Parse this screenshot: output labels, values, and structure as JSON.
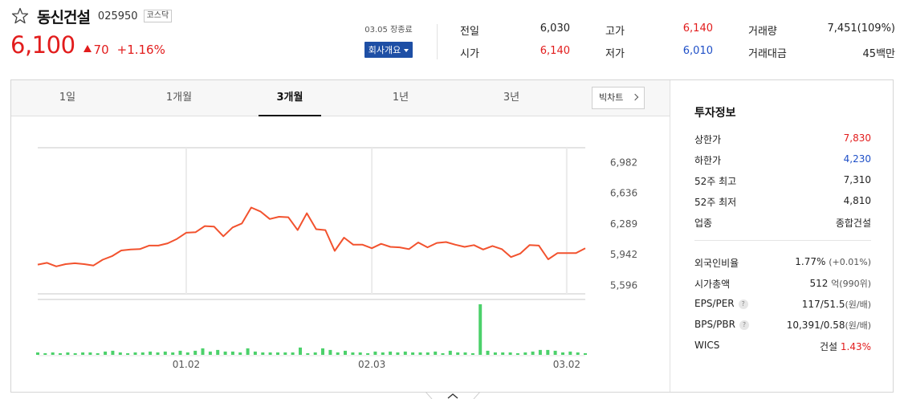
{
  "header": {
    "name": "동신건설",
    "code": "025950",
    "market": "코스닥",
    "price": "6,100",
    "change": "70",
    "change_pct": "+1.16%",
    "status": "03.05 장종료",
    "company_btn": "회사개요"
  },
  "quote": {
    "prev_label": "전일",
    "prev_value": "6,030",
    "open_label": "시가",
    "open_value": "6,140",
    "high_label": "고가",
    "high_value": "6,140",
    "low_label": "저가",
    "low_value": "6,010",
    "volume_label": "거래량",
    "volume_value": "7,451(109%)",
    "amount_label": "거래대금",
    "amount_value": "45백만"
  },
  "tabs": [
    "1일",
    "1개월",
    "3개월",
    "1년",
    "3년"
  ],
  "active_tab": "3개월",
  "bigchart_label": "빅차트",
  "colors": {
    "up": "#e21c1c",
    "down": "#1e4fc7",
    "line": "#f2522e",
    "volume": "#4cd16b"
  },
  "invest": {
    "title": "투자정보",
    "upper_label": "상한가",
    "upper_value": "7,830",
    "lower_label": "하한가",
    "lower_value": "4,230",
    "high52_label": "52주 최고",
    "high52_value": "7,310",
    "low52_label": "52주 최저",
    "low52_value": "4,810",
    "sector_label": "업종",
    "sector_value": "종합건설",
    "foreign_label": "외국인비율",
    "foreign_value": "1.77%",
    "foreign_change": "(+0.01%)",
    "mcap_label": "시가총액",
    "mcap_value": "512",
    "mcap_unit": "억(990위)",
    "eps_label": "EPS/PER",
    "eps_value": "117/51.5",
    "eps_unit": "(원/배)",
    "bps_label": "BPS/PBR",
    "bps_value": "10,391/0.58",
    "bps_unit": "(원/배)",
    "wics_label": "WICS",
    "wics_sector": "건설",
    "wics_value": "1.43%"
  },
  "chart_data": {
    "type": "line",
    "y_ticks": [
      "6,982",
      "6,636",
      "6,289",
      "5,942",
      "5,596"
    ],
    "y_tick_values": [
      6982,
      6636,
      6289,
      5942,
      5596
    ],
    "x_ticks": [
      "01.02",
      "02.03",
      "03.02"
    ],
    "x_tick_index": [
      16,
      36,
      57
    ],
    "ylim": [
      5500,
      7150
    ],
    "grid": true,
    "prices": [
      5830,
      5850,
      5810,
      5835,
      5845,
      5835,
      5820,
      5885,
      5925,
      5990,
      6000,
      6005,
      6045,
      6045,
      6070,
      6120,
      6190,
      6195,
      6265,
      6260,
      6150,
      6250,
      6295,
      6475,
      6430,
      6345,
      6370,
      6365,
      6220,
      6410,
      6230,
      6220,
      5985,
      6135,
      6055,
      6055,
      6015,
      6065,
      6030,
      6025,
      6005,
      6080,
      6025,
      6075,
      6085,
      6055,
      6030,
      6050,
      6000,
      6040,
      6005,
      5915,
      5955,
      6050,
      6045,
      5890,
      5960,
      5960,
      5960,
      6015
    ],
    "volumes": [
      3,
      2,
      3,
      2,
      3,
      2,
      3,
      3,
      2,
      4,
      5,
      3,
      2,
      3,
      3,
      4,
      3,
      4,
      3,
      5,
      3,
      5,
      8,
      4,
      6,
      4,
      4,
      3,
      8,
      4,
      3,
      3,
      3,
      3,
      3,
      9,
      2,
      3,
      8,
      6,
      3,
      5,
      3,
      3,
      2,
      4,
      3,
      4,
      3,
      4,
      3,
      3,
      3,
      4,
      2,
      5,
      3,
      3,
      2,
      62,
      5,
      3,
      3,
      3,
      2,
      3,
      4,
      6,
      6,
      5,
      3,
      4,
      3,
      2
    ],
    "volume_max": 65
  }
}
